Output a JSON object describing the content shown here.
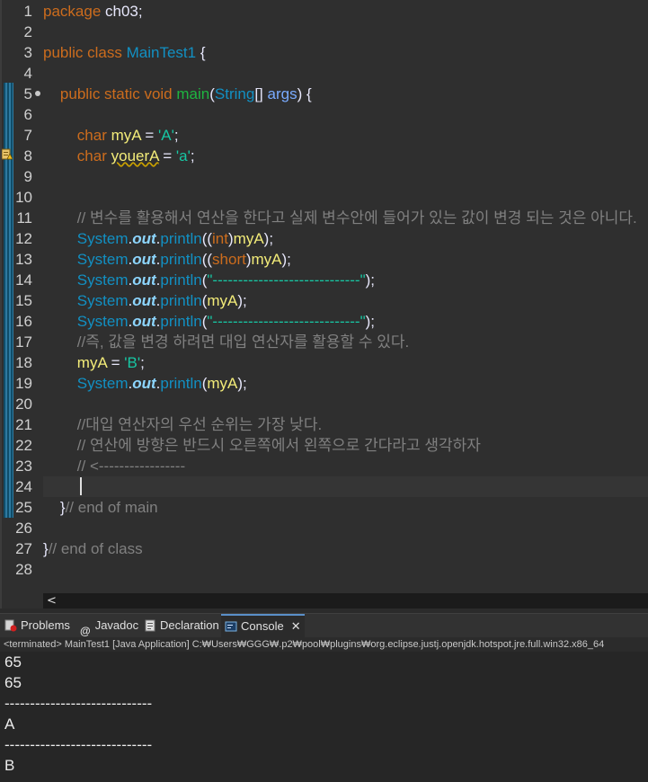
{
  "editor": {
    "lines": [
      {
        "n": "1",
        "t": [
          [
            "kw",
            "package"
          ],
          [
            "pl",
            " ch03;"
          ]
        ]
      },
      {
        "n": "2",
        "t": []
      },
      {
        "n": "3",
        "t": [
          [
            "kw",
            "public class"
          ],
          [
            "pl",
            " "
          ],
          [
            "cls",
            "MainTest1"
          ],
          [
            "pl",
            " {"
          ]
        ]
      },
      {
        "n": "4",
        "t": []
      },
      {
        "n": "5",
        "t": [
          [
            "pl",
            "    "
          ],
          [
            "kw",
            "public static void"
          ],
          [
            "pl",
            " "
          ],
          [
            "mth",
            "main"
          ],
          [
            "pl",
            "("
          ],
          [
            "cls",
            "String"
          ],
          [
            "pl",
            "[] "
          ],
          [
            "param",
            "args"
          ],
          [
            "pl",
            ") {"
          ]
        ]
      },
      {
        "n": "6",
        "t": []
      },
      {
        "n": "7",
        "t": [
          [
            "pl",
            "        "
          ],
          [
            "kw",
            "char"
          ],
          [
            "pl",
            " "
          ],
          [
            "var",
            "myA"
          ],
          [
            "pl",
            " = "
          ],
          [
            "str",
            "'A'"
          ],
          [
            "pl",
            ";"
          ]
        ]
      },
      {
        "n": "8",
        "t": [
          [
            "pl",
            "        "
          ],
          [
            "kw",
            "char"
          ],
          [
            "pl",
            " "
          ],
          [
            "varw",
            "youerA"
          ],
          [
            "pl",
            " = "
          ],
          [
            "str",
            "'a'"
          ],
          [
            "pl",
            ";"
          ]
        ]
      },
      {
        "n": "9",
        "t": []
      },
      {
        "n": "10",
        "t": []
      },
      {
        "n": "11",
        "t": [
          [
            "pl",
            "        "
          ],
          [
            "cm",
            "// 변수를 활용해서 연산을 한다고 실제 변수안에 들어가 있는 값이 변경 되는 것은 아니다."
          ]
        ]
      },
      {
        "n": "12",
        "t": [
          [
            "pl",
            "        "
          ],
          [
            "sysname",
            "System"
          ],
          [
            "pl",
            "."
          ],
          [
            "field",
            "out"
          ],
          [
            "pl",
            "."
          ],
          [
            "cls",
            "println"
          ],
          [
            "pl",
            "(("
          ],
          [
            "kw",
            "int"
          ],
          [
            "pl",
            ")"
          ],
          [
            "var",
            "myA"
          ],
          [
            "pl",
            ");"
          ]
        ]
      },
      {
        "n": "13",
        "t": [
          [
            "pl",
            "        "
          ],
          [
            "sysname",
            "System"
          ],
          [
            "pl",
            "."
          ],
          [
            "field",
            "out"
          ],
          [
            "pl",
            "."
          ],
          [
            "cls",
            "println"
          ],
          [
            "pl",
            "(("
          ],
          [
            "kw",
            "short"
          ],
          [
            "pl",
            ")"
          ],
          [
            "var",
            "myA"
          ],
          [
            "pl",
            ");"
          ]
        ]
      },
      {
        "n": "14",
        "t": [
          [
            "pl",
            "        "
          ],
          [
            "sysname",
            "System"
          ],
          [
            "pl",
            "."
          ],
          [
            "field",
            "out"
          ],
          [
            "pl",
            "."
          ],
          [
            "cls",
            "println"
          ],
          [
            "pl",
            "("
          ],
          [
            "str",
            "\"-----------------------------\""
          ],
          [
            "pl",
            ");"
          ]
        ]
      },
      {
        "n": "15",
        "t": [
          [
            "pl",
            "        "
          ],
          [
            "sysname",
            "System"
          ],
          [
            "pl",
            "."
          ],
          [
            "field",
            "out"
          ],
          [
            "pl",
            "."
          ],
          [
            "cls",
            "println"
          ],
          [
            "pl",
            "("
          ],
          [
            "var",
            "myA"
          ],
          [
            "pl",
            ");"
          ]
        ]
      },
      {
        "n": "16",
        "t": [
          [
            "pl",
            "        "
          ],
          [
            "sysname",
            "System"
          ],
          [
            "pl",
            "."
          ],
          [
            "field",
            "out"
          ],
          [
            "pl",
            "."
          ],
          [
            "cls",
            "println"
          ],
          [
            "pl",
            "("
          ],
          [
            "str",
            "\"-----------------------------\""
          ],
          [
            "pl",
            ");"
          ]
        ]
      },
      {
        "n": "17",
        "t": [
          [
            "pl",
            "        "
          ],
          [
            "cm",
            "//즉, 값을 변경 하려면 대입 연산자를 활용할 수 있다."
          ]
        ]
      },
      {
        "n": "18",
        "t": [
          [
            "pl",
            "        "
          ],
          [
            "var",
            "myA"
          ],
          [
            "pl",
            " = "
          ],
          [
            "str",
            "'B'"
          ],
          [
            "pl",
            ";"
          ]
        ]
      },
      {
        "n": "19",
        "t": [
          [
            "pl",
            "        "
          ],
          [
            "sysname",
            "System"
          ],
          [
            "pl",
            "."
          ],
          [
            "field",
            "out"
          ],
          [
            "pl",
            "."
          ],
          [
            "cls",
            "println"
          ],
          [
            "pl",
            "("
          ],
          [
            "var",
            "myA"
          ],
          [
            "pl",
            ");"
          ]
        ]
      },
      {
        "n": "20",
        "t": []
      },
      {
        "n": "21",
        "t": [
          [
            "pl",
            "        "
          ],
          [
            "cm",
            "//대입 연산자의 우선 순위는 가장 낮다."
          ]
        ]
      },
      {
        "n": "22",
        "t": [
          [
            "pl",
            "        "
          ],
          [
            "cm",
            "// 연산에 방향은 반드시 오른쪽에서 왼쪽으로 간다라고 생각하자"
          ]
        ]
      },
      {
        "n": "23",
        "t": [
          [
            "pl",
            "        "
          ],
          [
            "cm",
            "// <-----------------"
          ]
        ]
      },
      {
        "n": "24",
        "t": []
      },
      {
        "n": "25",
        "t": [
          [
            "pl",
            "    }"
          ],
          [
            "cm",
            "// end of main"
          ]
        ]
      },
      {
        "n": "26",
        "t": []
      },
      {
        "n": "27",
        "t": [
          [
            "pl",
            "}"
          ],
          [
            "cm",
            "// end of class"
          ]
        ]
      },
      {
        "n": "28",
        "t": []
      }
    ],
    "scroll_arrow": "<"
  },
  "tabs": {
    "problems": "Problems",
    "javadoc": "Javadoc",
    "declaration": "Declaration",
    "console": "Console",
    "close": "✕"
  },
  "console": {
    "status": "<terminated> MainTest1 [Java Application] C:₩Users₩GGG₩.p2₩pool₩plugins₩org.eclipse.justj.openjdk.hotspot.jre.full.win32.x86_64",
    "output": [
      "65",
      "65",
      "-----------------------------",
      "A",
      "-----------------------------",
      "B"
    ]
  },
  "colors": {
    "keyword": "#cc6c1d",
    "class": "#1290c3",
    "method": "#1eb540",
    "string": "#17c6a3",
    "variable": "#f3ec79",
    "comment": "#808080",
    "background": "#2f2f2f"
  }
}
